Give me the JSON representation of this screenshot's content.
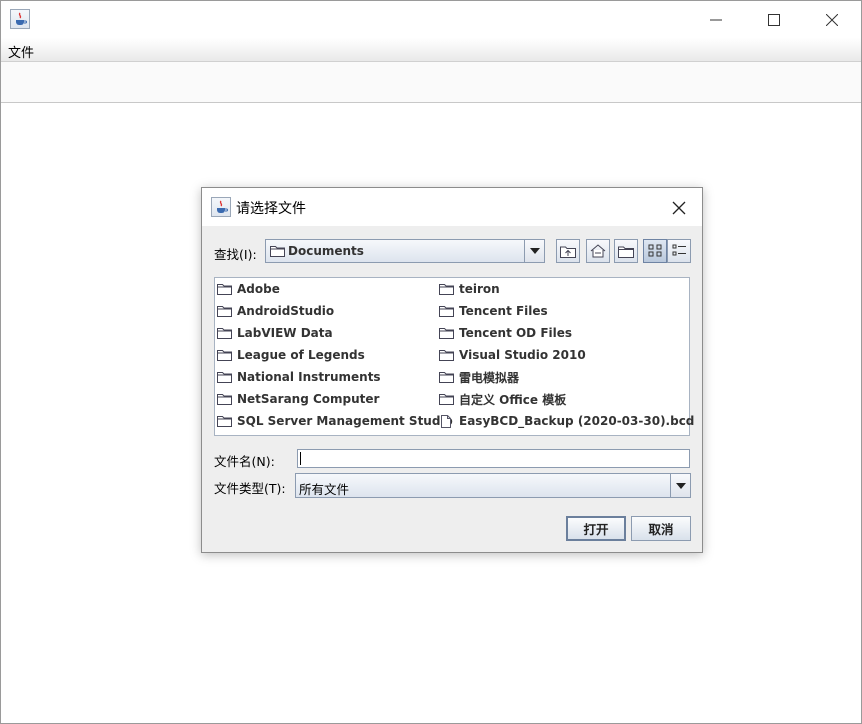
{
  "main_window": {
    "menu": {
      "file_label": "文件"
    }
  },
  "dialog": {
    "title": "请选择文件",
    "look_in_label": "查找(I):",
    "look_in_value": "Documents",
    "file_name_label": "文件名(N):",
    "file_name_value": "",
    "file_type_label": "文件类型(T):",
    "file_type_value": "所有文件",
    "open_button": "打开",
    "cancel_button": "取消",
    "files": [
      {
        "name": "Adobe",
        "kind": "folder"
      },
      {
        "name": "AndroidStudio",
        "kind": "folder"
      },
      {
        "name": "LabVIEW Data",
        "kind": "folder"
      },
      {
        "name": "League of Legends",
        "kind": "folder"
      },
      {
        "name": "National Instruments",
        "kind": "folder"
      },
      {
        "name": "NetSarang Computer",
        "kind": "folder"
      },
      {
        "name": "SQL Server Management Studio",
        "kind": "folder"
      },
      {
        "name": "teiron",
        "kind": "folder"
      },
      {
        "name": "Tencent Files",
        "kind": "folder"
      },
      {
        "name": "Tencent OD Files",
        "kind": "folder"
      },
      {
        "name": "Visual Studio 2010",
        "kind": "folder"
      },
      {
        "name": "雷电模拟器",
        "kind": "folder"
      },
      {
        "name": "自定义 Office 模板",
        "kind": "folder"
      },
      {
        "name": "EasyBCD_Backup (2020-03-30).bcd",
        "kind": "file"
      }
    ]
  },
  "colors": {
    "dialog_bg": "#eeeeee",
    "border": "#8c9bb0",
    "text": "#333333"
  },
  "icons": [
    "java-app-icon",
    "minimize-icon",
    "maximize-icon",
    "close-icon",
    "folder-icon",
    "file-icon",
    "up-folder-icon",
    "home-icon",
    "new-folder-icon",
    "list-view-icon",
    "details-view-icon",
    "chevron-down-icon"
  ]
}
